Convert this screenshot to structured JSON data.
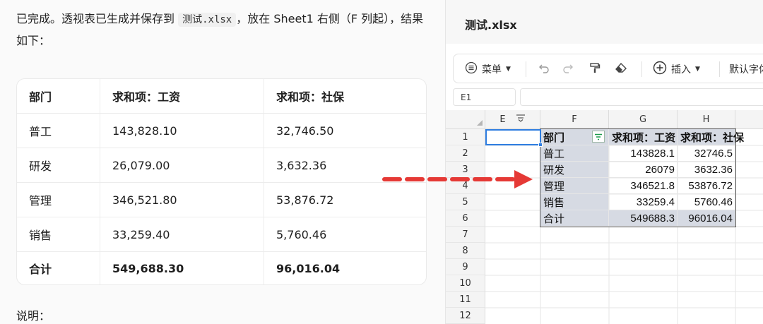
{
  "chat": {
    "intro_before": "已完成。透视表已生成并保存到 ",
    "intro_file": "测试.xlsx",
    "intro_after": "，放在 Sheet1 右侧（F 列起），结果如下：",
    "table": {
      "headers": [
        "部门",
        "求和项：工资",
        "求和项：社保"
      ],
      "rows": [
        [
          "普工",
          "143,828.10",
          "32,746.50"
        ],
        [
          "研发",
          "26,079.00",
          "3,632.36"
        ],
        [
          "管理",
          "346,521.80",
          "53,876.72"
        ],
        [
          "销售",
          "33,259.40",
          "5,760.46"
        ]
      ],
      "total": [
        "合计",
        "549,688.30",
        "96,016.04"
      ]
    },
    "note": "说明："
  },
  "sheet": {
    "file_name": "测试.xlsx",
    "toolbar": {
      "menu_icon": "list-icon",
      "menu_label": "菜单",
      "undo_icon": "undo-icon",
      "redo_icon": "redo-icon",
      "format_painter_icon": "format-painter-icon",
      "eraser_icon": "eraser-icon",
      "insert_icon": "plus-circle-icon",
      "insert_label": "插入",
      "font_label": "默认字体"
    },
    "name_box": "E1",
    "columns": [
      "E",
      "F",
      "G",
      "H"
    ],
    "row_numbers": [
      "1",
      "2",
      "3",
      "4",
      "5",
      "6",
      "7",
      "8",
      "9",
      "10",
      "11",
      "12"
    ],
    "pivot": {
      "header": [
        "部门",
        "求和项：工资",
        "求和项：社保"
      ],
      "rows": [
        [
          "普工",
          "143828.1",
          "32746.5"
        ],
        [
          "研发",
          "26079",
          "3632.36"
        ],
        [
          "管理",
          "346521.8",
          "53876.72"
        ],
        [
          "销售",
          "33259.4",
          "5760.46"
        ],
        [
          "合计",
          "549688.3",
          "96016.04"
        ]
      ]
    },
    "colors": {
      "pivot_fill": "#d6dae3",
      "selection": "#2e7de0",
      "arrow": "#e53935"
    }
  }
}
